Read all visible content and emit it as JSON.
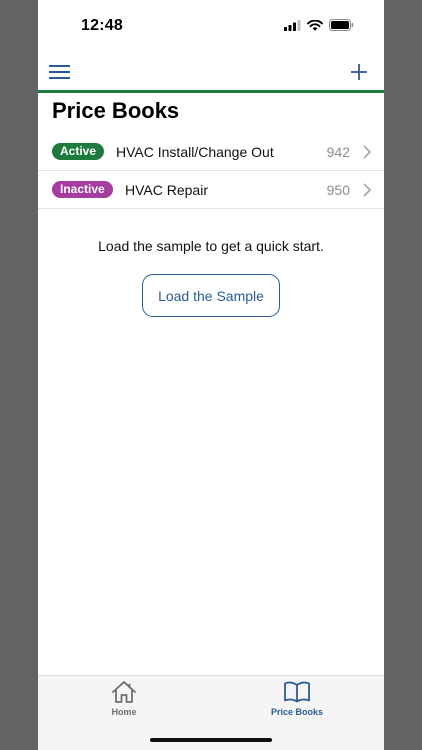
{
  "status_bar": {
    "time": "12:48"
  },
  "navbar": {
    "menu_icon": "hamburger-menu-icon",
    "add_icon": "plus-icon",
    "accent_color": "#1f7a3e"
  },
  "page": {
    "title": "Price Books"
  },
  "price_books": [
    {
      "status": "Active",
      "status_color": "#1f7a3e",
      "name": "HVAC Install/Change Out",
      "count": "942"
    },
    {
      "status": "Inactive",
      "status_color": "#a53ca0",
      "name": "HVAC Repair",
      "count": "950"
    }
  ],
  "sample": {
    "prompt": "Load the sample to get a quick start.",
    "button_label": "Load the Sample"
  },
  "tabbar": {
    "tabs": [
      {
        "label": "Home",
        "icon": "house-icon",
        "selected": false
      },
      {
        "label": "Price Books",
        "icon": "open-book-icon",
        "selected": true
      }
    ]
  }
}
